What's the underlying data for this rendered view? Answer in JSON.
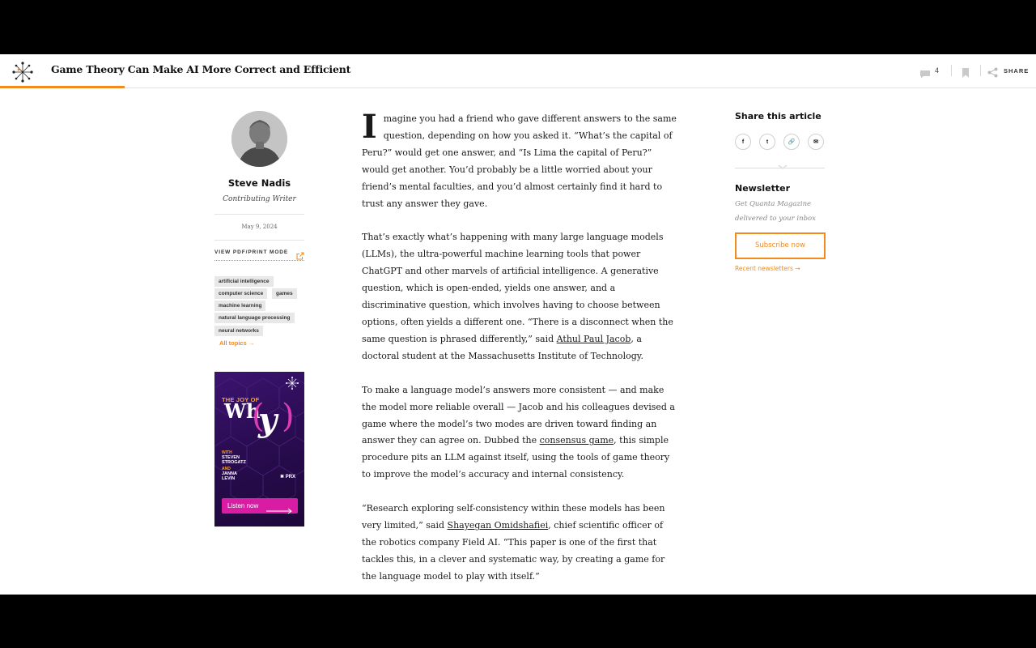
{
  "header": {
    "title": "Game Theory Can Make AI More Correct and Efficient",
    "comment_count": "4",
    "share_label": "SHARE",
    "reading_progress": 0.12
  },
  "author": {
    "name": "Steve Nadis",
    "role": "Contributing Writer",
    "date": "May 9, 2024",
    "pdf_link": "VIEW PDF/PRINT MODE"
  },
  "tags": [
    "artificial intelligence",
    "computer science",
    "games",
    "machine learning",
    "natural language processing",
    "neural networks"
  ],
  "all_topics": "All topics →",
  "ad": {
    "kicker": "THE JOY OF",
    "title_a": "Wh",
    "title_b": "y",
    "paren_open": "(",
    "paren_close": ")",
    "with": "WITH",
    "host1_first": "STEVEN",
    "host1_last": "STROGATZ",
    "and": "AND",
    "host2_first": "JANNA",
    "host2_last": "LEVIN",
    "brand": "✖ PRX",
    "button": "Listen now"
  },
  "article": {
    "p1_dropcap": "I",
    "p1": "magine you had a friend who gave different answers to the same question, depending on how you asked it. “What’s the capital of Peru?” would get one answer, and “Is Lima the capital of Peru?” would get another. You’d probably be a little worried about your friend’s mental faculties, and you’d almost certainly find it hard to trust any answer they gave.",
    "p2_a": "That’s exactly what’s happening with many large language models (LLMs), the ultra-powerful machine learning tools that power ChatGPT and other marvels of artificial intelligence. A generative question, which is open-ended, yields one answer, and a discriminative question, which involves having to choose between options, often yields a different one. “There is a disconnect when the same question is phrased differently,” said ",
    "p2_link": "Athul Paul Jacob",
    "p2_b": ", a doctoral student at the Massachusetts Institute of Technology.",
    "p3_a": "To make a language model’s answers more consistent — and make the model more reliable overall — Jacob and his colleagues devised a game where the model’s two modes are driven toward finding an answer they can agree on. Dubbed the ",
    "p3_link": "consensus game",
    "p3_b": ", this simple procedure pits an LLM against itself, using the tools of game theory to improve the model’s accuracy and internal consistency.",
    "p4_a": "“Research exploring self-consistency within these models has been very limited,” said ",
    "p4_link": "Shayegan Omidshafiei",
    "p4_b": ", chief scientific officer of the robotics company Field AI. “This paper is one of the first that tackles this, in a clever and systematic way, by creating a game for the language model to play with itself.”"
  },
  "sidebar_right": {
    "share_heading": "Share this article",
    "share_buttons": [
      "f",
      "t",
      "🔗",
      "✉"
    ],
    "newsletter_heading": "Newsletter",
    "newsletter_desc": "Get Quanta Magazine delivered to your inbox",
    "subscribe_button": "Subscribe now",
    "recent_link": "Recent newsletters →"
  },
  "colors": {
    "accent": "#f28a1d",
    "ad_magenta": "#d81ca3",
    "ad_purple": "#2a0c52"
  }
}
